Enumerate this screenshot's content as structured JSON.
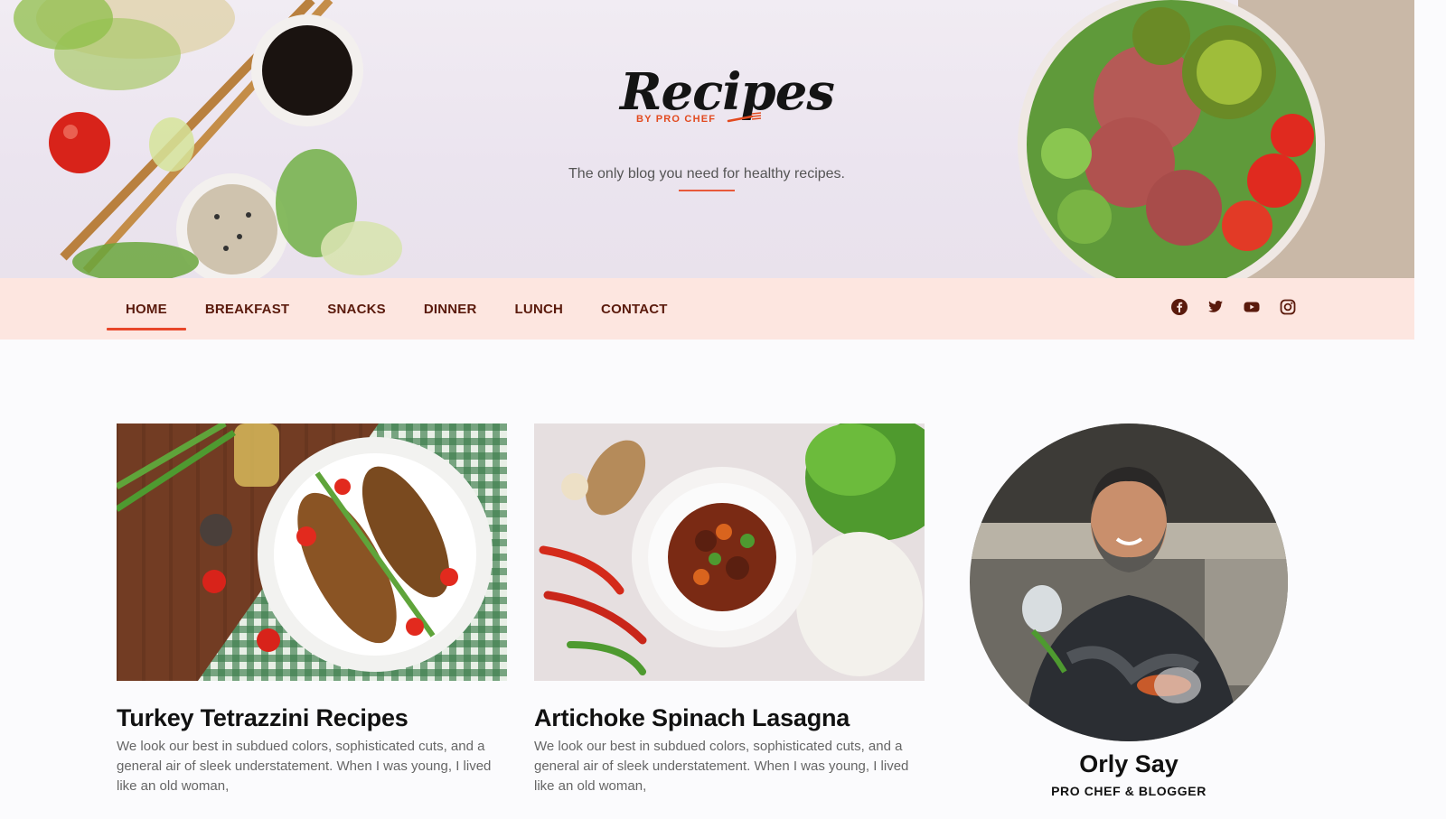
{
  "header": {
    "logo_text": "Recipes",
    "logo_subtext": "BY PRO CHEF",
    "tagline": "The only blog you need for healthy recipes."
  },
  "nav": {
    "items": [
      {
        "label": "HOME",
        "active": true
      },
      {
        "label": "BREAKFAST",
        "active": false
      },
      {
        "label": "SNACKS",
        "active": false
      },
      {
        "label": "DINNER",
        "active": false
      },
      {
        "label": "LUNCH",
        "active": false
      },
      {
        "label": "CONTACT",
        "active": false
      }
    ],
    "social": [
      "facebook-icon",
      "twitter-icon",
      "youtube-icon",
      "instagram-icon"
    ]
  },
  "posts": [
    {
      "title": "Turkey Tetrazzini Recipes",
      "excerpt": "We look our best in subdued colors, sophisticated cuts, and a general air of sleek understatement. When I was young, I lived like an old woman,"
    },
    {
      "title": "Artichoke Spinach Lasagna",
      "excerpt": "We look our best in subdued colors, sophisticated cuts, and a general air of sleek understatement. When I was young, I lived like an old woman,"
    }
  ],
  "author": {
    "name": "Orly Say",
    "role": "PRO CHEF & BLOGGER"
  },
  "colors": {
    "accent": "#e8472a",
    "nav_bg": "#fde6e0",
    "nav_text": "#5a1a0c"
  }
}
